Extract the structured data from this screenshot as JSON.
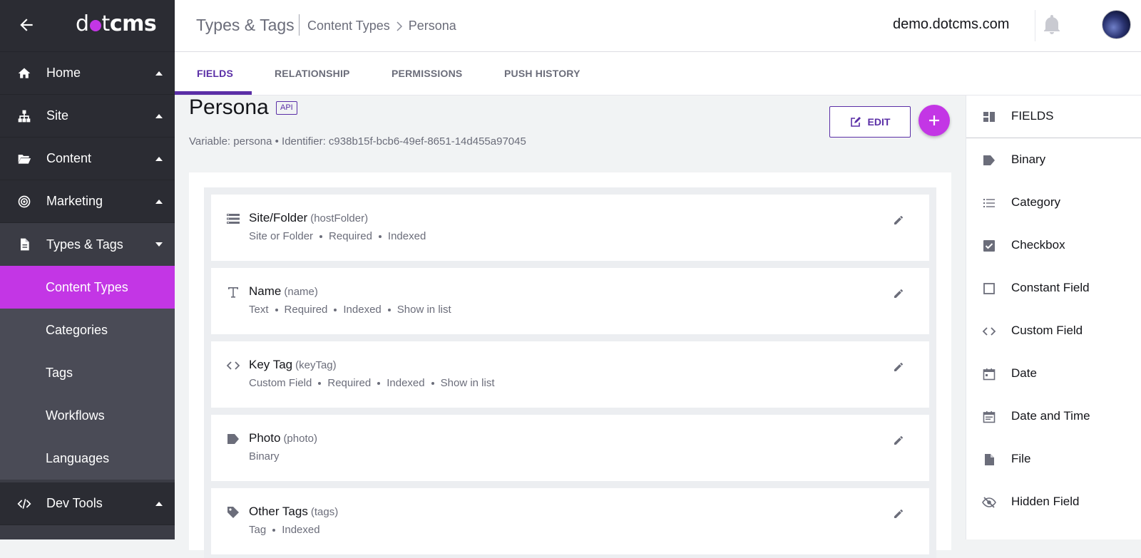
{
  "sidebar": {
    "logo": {
      "prefix": "d",
      "mid": "t",
      "suffix": "cms"
    },
    "items": [
      {
        "label": "Home",
        "icon": "home-icon"
      },
      {
        "label": "Site",
        "icon": "sitemap-icon"
      },
      {
        "label": "Content",
        "icon": "folder-open-icon"
      },
      {
        "label": "Marketing",
        "icon": "target-icon"
      },
      {
        "label": "Types & Tags",
        "icon": "document-icon"
      }
    ],
    "subitems": [
      "Content Types",
      "Categories",
      "Tags",
      "Workflows",
      "Languages"
    ],
    "devtools": {
      "label": "Dev Tools",
      "icon": "code-icon"
    }
  },
  "header": {
    "title": "Types & Tags",
    "crumb1": "Content Types",
    "crumb2": "Persona",
    "site": "demo.dotcms.com"
  },
  "tabs": [
    "FIELDS",
    "RELATIONSHIP",
    "PERMISSIONS",
    "PUSH HISTORY"
  ],
  "content_type": {
    "name": "Persona",
    "api_label": "API",
    "meta": "Variable: persona • Identifier: c938b15f-bcb6-49ef-8651-14d455a97045",
    "edit_label": "EDIT"
  },
  "fields": [
    {
      "name": "Site/Folder",
      "var": "(hostFolder)",
      "props": [
        "Site or Folder",
        "Required",
        "Indexed"
      ],
      "icon": "list-icon"
    },
    {
      "name": "Name",
      "var": "(name)",
      "props": [
        "Text",
        "Required",
        "Indexed",
        "Show in list"
      ],
      "icon": "text-icon"
    },
    {
      "name": "Key Tag",
      "var": "(keyTag)",
      "props": [
        "Custom Field",
        "Required",
        "Indexed",
        "Show in list"
      ],
      "icon": "code-icon"
    },
    {
      "name": "Photo",
      "var": "(photo)",
      "props": [
        "Binary"
      ],
      "icon": "label-icon"
    },
    {
      "name": "Other Tags",
      "var": "(tags)",
      "props": [
        "Tag",
        "Indexed"
      ],
      "icon": "tag-icon"
    }
  ],
  "palette": {
    "header": "FIELDS",
    "items": [
      "Binary",
      "Category",
      "Checkbox",
      "Constant Field",
      "Custom Field",
      "Date",
      "Date and Time",
      "File",
      "Hidden Field"
    ]
  },
  "colors": {
    "accent": "#c336e5",
    "primary": "#5a2ea6",
    "sidebar": "#3b3c45"
  }
}
